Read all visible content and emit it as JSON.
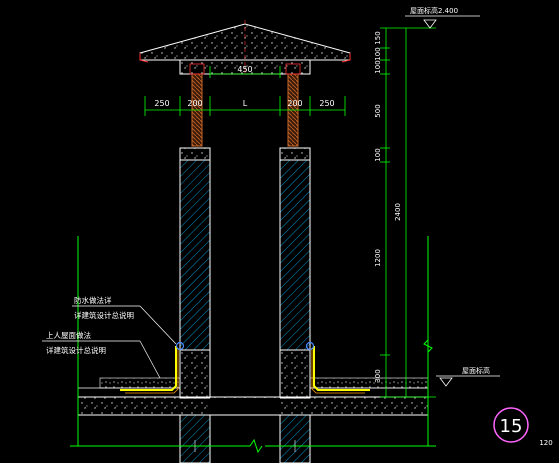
{
  "drawing": {
    "roof_elevation_label": "屋面标高2.400",
    "roof_surface_label": "屋面标高",
    "waterproof_note_1": "防水做法详",
    "waterproof_note_2": "详建筑设计总说明",
    "upper_note_1": "上人屋面做法",
    "upper_note_2": "详建筑设计总说明",
    "detail_number": "15",
    "sheet_number": "120"
  },
  "dimensions": {
    "top_width": "450",
    "plan_left": "250",
    "plan_mid_left": "200",
    "plan_span": "L",
    "plan_mid_right": "200",
    "plan_right": "250",
    "vertical": [
      "150",
      "100",
      "100",
      "500",
      "100",
      "1200",
      "300"
    ],
    "total_height": "2400"
  },
  "colors": {
    "background": "#000000",
    "outline": "#ffffff",
    "dimension": "#00ff00",
    "hatch": "#00b8ff",
    "waterproof": "#ffff00",
    "grade_line": "#00ffff",
    "text": "#ffffff",
    "detail_circle": "#ff66ff",
    "window_frame": "#c86428"
  }
}
